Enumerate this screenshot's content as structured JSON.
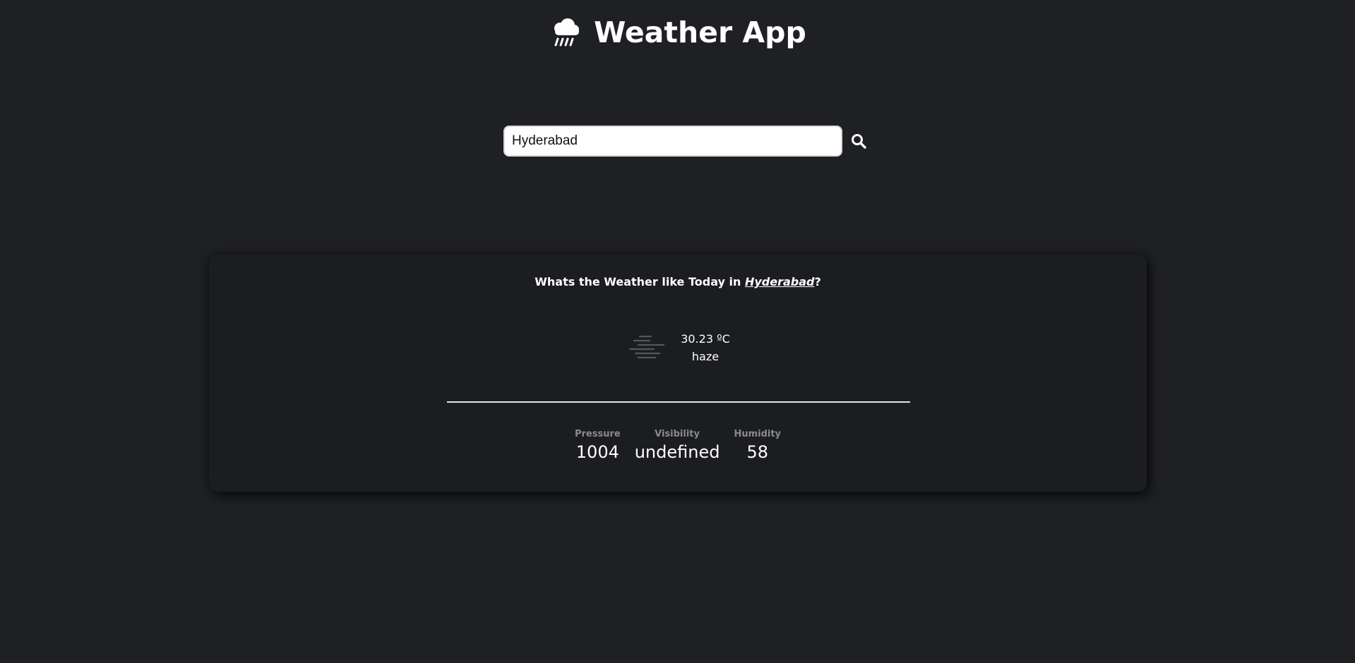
{
  "header": {
    "title": "Weather App",
    "icon": "rain-cloud-icon"
  },
  "search": {
    "value": "Hyderabad",
    "placeholder": "",
    "button_icon": "search-icon"
  },
  "card": {
    "title_prefix": "Whats the Weather like Today in ",
    "city": "Hyderabad",
    "title_suffix": "?",
    "temperature": "30.23 ºC",
    "condition": "haze",
    "condition_icon": "haze-icon",
    "stats": [
      {
        "label": "Pressure",
        "value": "1004"
      },
      {
        "label": "Visibility",
        "value": "undefined"
      },
      {
        "label": "Humidity",
        "value": "58"
      }
    ]
  },
  "colors": {
    "background": "#1f2024",
    "card": "#1c1d20",
    "text": "#ffffff",
    "muted": "#8a8a8a"
  }
}
